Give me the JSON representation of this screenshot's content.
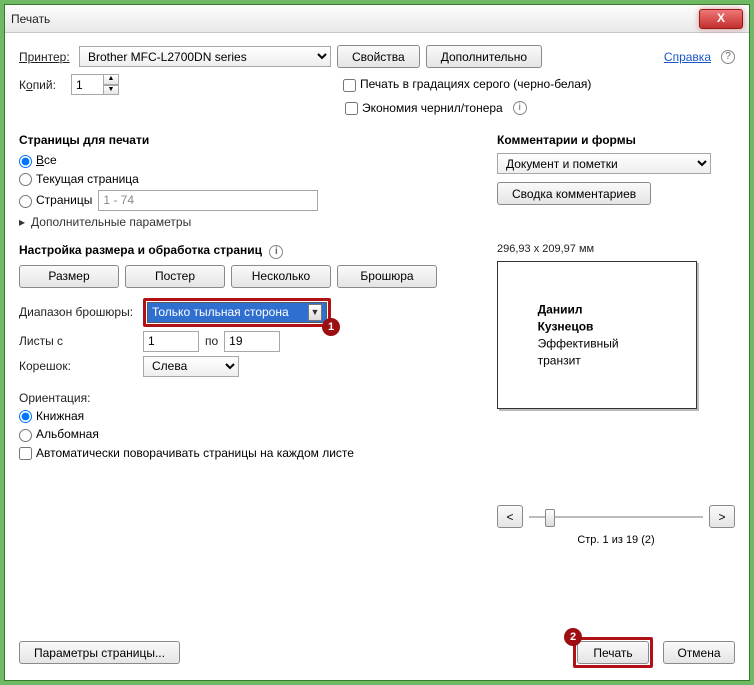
{
  "window": {
    "title": "Печать",
    "close": "X"
  },
  "printer": {
    "label": "Принтер:",
    "selected": "Brother MFC-L2700DN series",
    "properties_btn": "Свойства",
    "advanced_btn": "Дополнительно",
    "help_link": "Справка"
  },
  "copies": {
    "label_prefix": "К",
    "label_key": "о",
    "label_suffix": "пий:",
    "value": "1"
  },
  "options": {
    "grayscale": "Печать в градациях серого (черно-белая)",
    "ink_save": "Экономия чернил/тонера"
  },
  "pages": {
    "title": "Страницы для печати",
    "all_prefix": "В",
    "all_key": "с",
    "all_suffix": "е",
    "current": "Текущая страница",
    "range_label": "Страницы",
    "range_value": "1 - 74",
    "more": "Дополнительные параметры"
  },
  "sizing": {
    "title": "Настройка размера и обработка страниц",
    "size_btn": "Размер",
    "poster_btn": "Постер",
    "multi_btn": "Несколько",
    "booklet_btn": "Брошюра",
    "booklet_range_label": "Диапазон брошюры:",
    "booklet_range_value": "Только тыльная сторона",
    "sheets_from_label": "Листы с",
    "sheets_from": "1",
    "sheets_to_label": "по",
    "sheets_to": "19",
    "binding_label": "Корешок:",
    "binding_value": "Слева"
  },
  "orientation": {
    "title": "Ориентация:",
    "portrait": "Книжная",
    "landscape": "Альбомная",
    "auto_rotate": "Автоматически поворачивать страницы на каждом листе"
  },
  "comments": {
    "title": "Комментарии и формы",
    "selected": "Документ и пометки",
    "summary_btn": "Сводка комментариев"
  },
  "preview": {
    "dimensions": "296,93 x 209,97 мм",
    "doc_line1": "Даниил Кузнецов",
    "doc_line2": "Эффективный транзит",
    "prev": "<",
    "next": ">",
    "page_info": "Стр. 1 из 19 (2)"
  },
  "footer": {
    "page_setup": "Параметры страницы...",
    "print": "Печать",
    "cancel": "Отмена"
  },
  "badges": {
    "one": "1",
    "two": "2"
  }
}
